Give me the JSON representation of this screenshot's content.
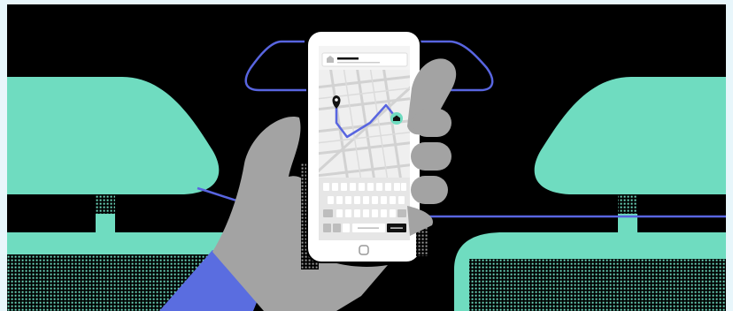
{
  "scene": {
    "colors": {
      "background": "#000000",
      "page_border": "#e8f6fb",
      "seat": "#6fdcc0",
      "route_line": "#5865e0",
      "hand": "#a3a3a3",
      "sleeve": "#5a6de0",
      "phone_body": "#ffffff",
      "map_bg": "#efefef",
      "map_streets": "#d2d2d2",
      "keyboard_bg": "#e6e6e6",
      "key": "#ffffff",
      "pin": "#111111",
      "home_marker": "#6fdcc0"
    },
    "icons": {
      "status_home": "home-icon",
      "start_pin": "location-pin-icon",
      "destination": "home-icon",
      "phone_button": "home-button"
    }
  }
}
